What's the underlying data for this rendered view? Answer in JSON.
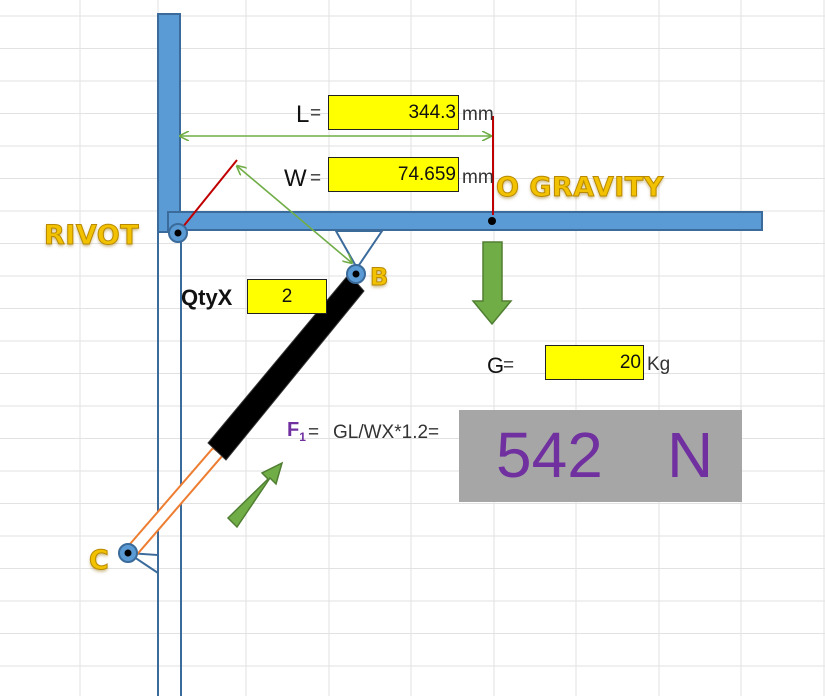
{
  "labels": {
    "L": "L",
    "W": "W",
    "equals": "=",
    "qty": "QtyX",
    "G": "G",
    "F_main": "F",
    "F_sub": "1",
    "formula": "GL/WX*1.2="
  },
  "values": {
    "L": "344.3",
    "W": "74.659",
    "qty": "2",
    "G": "20"
  },
  "units": {
    "L": "mm",
    "W": "mm",
    "G": "Kg"
  },
  "points": {
    "rivot": "RIVOT",
    "gravity": "O GRAVITY",
    "B": "B",
    "C": "C"
  },
  "result": {
    "value": "542",
    "unit": "N"
  },
  "colors": {
    "beam": "#5b9bd5",
    "beam_border": "#3a6b9b",
    "cylinder": "#000000",
    "rod": "#f4b183",
    "rod_border": "#ed7d31",
    "arrow_green": "#70ad47",
    "dimension_line": "#70ad47",
    "red_line": "#c00000",
    "highlight": "#ffff00",
    "result_bg": "#a6a6a6",
    "result_text": "#7030a0",
    "label_gold": "#f2c200"
  }
}
